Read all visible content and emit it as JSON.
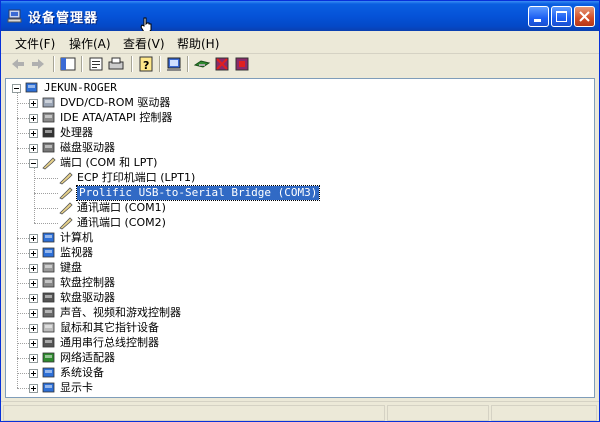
{
  "window": {
    "title": "设备管理器",
    "accent": "#0553d8",
    "buttons": [
      "minimize-icon",
      "maximize-icon",
      "close-icon"
    ]
  },
  "menu": [
    {
      "label": "文件(F)"
    },
    {
      "label": "操作(A)"
    },
    {
      "label": "查看(V)"
    },
    {
      "label": "帮助(H)"
    }
  ],
  "toolbar": [
    "back-arrow-icon",
    "forward-arrow-icon",
    "show-hide-tree-icon",
    "properties-icon",
    "print-icon",
    "help-icon",
    "scan-hardware-icon",
    "update-driver-icon",
    "disable-device-icon",
    "uninstall-device-icon"
  ],
  "tree": {
    "root": "JEKUN-ROGER",
    "categories": [
      {
        "label": "DVD/CD-ROM 驱动器",
        "icon": "cdrom-icon"
      },
      {
        "label": "IDE ATA/ATAPI 控制器",
        "icon": "ide-controller-icon"
      },
      {
        "label": "处理器",
        "icon": "processor-icon"
      },
      {
        "label": "磁盘驱动器",
        "icon": "disk-drive-icon"
      },
      {
        "label": "端口 (COM 和 LPT)",
        "icon": "port-icon",
        "expanded": true,
        "children": [
          {
            "label": "ECP 打印机端口 (LPT1)"
          },
          {
            "label": "Prolific USB-to-Serial Bridge (COM3)",
            "selected": true
          },
          {
            "label": "通讯端口 (COM1)"
          },
          {
            "label": "通讯端口 (COM2)"
          }
        ]
      },
      {
        "label": "计算机",
        "icon": "computer-icon"
      },
      {
        "label": "监视器",
        "icon": "monitor-icon"
      },
      {
        "label": "键盘",
        "icon": "keyboard-icon"
      },
      {
        "label": "软盘控制器",
        "icon": "floppy-controller-icon"
      },
      {
        "label": "软盘驱动器",
        "icon": "floppy-drive-icon"
      },
      {
        "label": "声音、视频和游戏控制器",
        "icon": "sound-icon"
      },
      {
        "label": "鼠标和其它指针设备",
        "icon": "mouse-icon"
      },
      {
        "label": "通用串行总线控制器",
        "icon": "usb-icon"
      },
      {
        "label": "网络适配器",
        "icon": "network-adapter-icon"
      },
      {
        "label": "系统设备",
        "icon": "system-device-icon"
      },
      {
        "label": "显示卡",
        "icon": "display-adapter-icon"
      }
    ]
  }
}
